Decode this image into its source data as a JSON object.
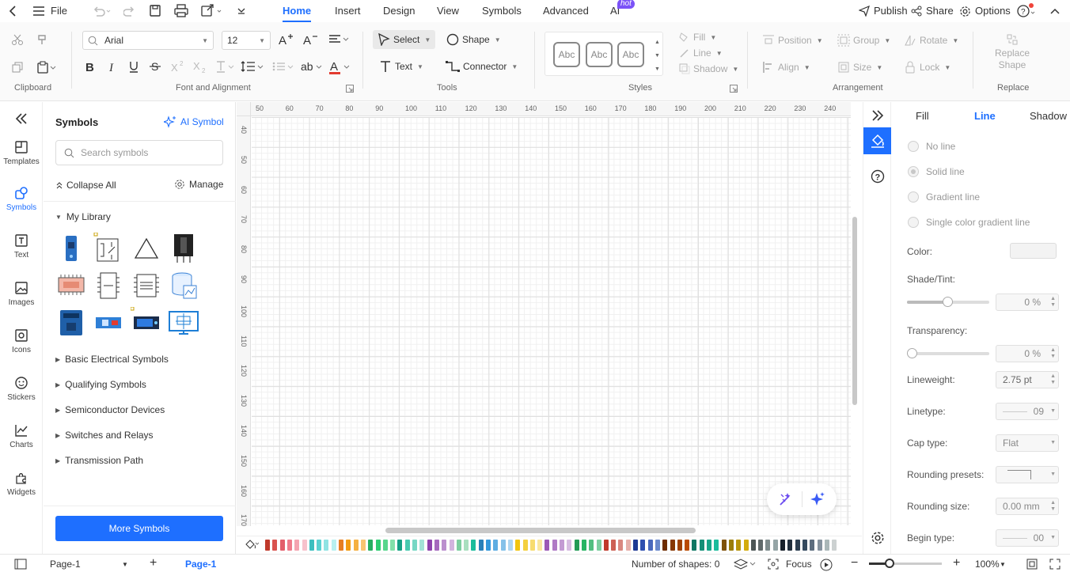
{
  "menubar": {
    "file_label": "File",
    "tabs": [
      {
        "label": "Home",
        "active": true
      },
      {
        "label": "Insert"
      },
      {
        "label": "Design"
      },
      {
        "label": "View"
      },
      {
        "label": "Symbols"
      },
      {
        "label": "Advanced"
      },
      {
        "label": "AI",
        "badge": "hot"
      }
    ],
    "publish_label": "Publish",
    "share_label": "Share",
    "options_label": "Options"
  },
  "ribbon": {
    "groups": {
      "clipboard": "Clipboard",
      "font": "Font and Alignment",
      "tools": "Tools",
      "styles": "Styles",
      "arrangement": "Arrangement",
      "replace": "Replace"
    },
    "font_family": "Arial",
    "font_size": "12",
    "select_label": "Select",
    "shape_label": "Shape",
    "text_label": "Text",
    "connector_label": "Connector",
    "style_samples": [
      "Abc",
      "Abc",
      "Abc"
    ],
    "fill_label": "Fill",
    "line_label": "Line",
    "shadow_label": "Shadow",
    "position_label": "Position",
    "group_label": "Group",
    "rotate_label": "Rotate",
    "align_label": "Align",
    "size_label": "Size",
    "lock_label": "Lock",
    "replace_shape_label": "Replace Shape"
  },
  "leftbar": {
    "items": [
      {
        "label": "Templates"
      },
      {
        "label": "Symbols",
        "active": true
      },
      {
        "label": "Text"
      },
      {
        "label": "Images"
      },
      {
        "label": "Icons"
      },
      {
        "label": "Stickers"
      },
      {
        "label": "Charts"
      },
      {
        "label": "Widgets"
      }
    ]
  },
  "symbols_panel": {
    "title": "Symbols",
    "ai_symbol_label": "AI Symbol",
    "search_placeholder": "Search symbols",
    "collapse_all_label": "Collapse All",
    "manage_label": "Manage",
    "my_library_label": "My Library",
    "categories": [
      "Basic Electrical Symbols",
      "Qualifying Symbols",
      "Semiconductor Devices",
      "Switches and Relays",
      "Transmission Path"
    ],
    "more_symbols_label": "More Symbols"
  },
  "ruler": {
    "top": [
      "50",
      "60",
      "70",
      "80",
      "90",
      "100",
      "110",
      "120",
      "130",
      "140",
      "150",
      "160",
      "170",
      "180",
      "190",
      "200",
      "210",
      "220",
      "230",
      "240"
    ],
    "left": [
      "40",
      "50",
      "60",
      "70",
      "80",
      "90",
      "100",
      "110",
      "120",
      "130",
      "140",
      "150",
      "160",
      "170"
    ]
  },
  "palette_colors": [
    "#c0392b",
    "#d9534f",
    "#e35d6a",
    "#ef7b8b",
    "#f4a3b0",
    "#f7c2cc",
    "#3bbfbf",
    "#5ad1d1",
    "#8fe3e3",
    "#b8f0f0",
    "#e67e22",
    "#f39c12",
    "#f5b041",
    "#f8c471",
    "#27ae60",
    "#2ecc71",
    "#58d68d",
    "#82e0aa",
    "#16a085",
    "#48c9b0",
    "#76d7c4",
    "#a3e4d7",
    "#8e44ad",
    "#a569bd",
    "#bb8fce",
    "#d2b4de",
    "#7dcea0",
    "#a9dfbf",
    "#1abc9c",
    "#2980b9",
    "#3498db",
    "#5dade2",
    "#85c1e9",
    "#aed6f1",
    "#f1c40f",
    "#f4d03f",
    "#f7dc6f",
    "#f9e79f",
    "#9b59b6",
    "#af7ac5",
    "#c39bd3",
    "#d7bde2",
    "#239b56",
    "#28b463",
    "#52be80",
    "#7dcea0",
    "#c0392b",
    "#cd6155",
    "#d98880",
    "#e6b0aa",
    "#1f3a93",
    "#2e4fb0",
    "#4a69bd",
    "#6a89cc",
    "#6e2c00",
    "#873600",
    "#a04000",
    "#ba4a00",
    "#117864",
    "#148f77",
    "#17a589",
    "#1abc9c",
    "#7e5109",
    "#9a7d0a",
    "#b7950b",
    "#d4ac0d",
    "#4d5656",
    "#616a6b",
    "#7f8c8d",
    "#95a5a6",
    "#17202a",
    "#212f3d",
    "#2c3e50",
    "#34495e",
    "#5d6d7e",
    "#85929e",
    "#aab7b8",
    "#ccd1d1"
  ],
  "right_panel": {
    "tabs": [
      {
        "label": "Fill"
      },
      {
        "label": "Line",
        "active": true
      },
      {
        "label": "Shadow"
      }
    ],
    "line_options": [
      "No line",
      "Solid line",
      "Gradient line",
      "Single color gradient line"
    ],
    "color_label": "Color:",
    "shade_label": "Shade/Tint:",
    "shade_value": "0 %",
    "transparency_label": "Transparency:",
    "transparency_value": "0 %",
    "lineweight_label": "Lineweight:",
    "lineweight_value": "2.75 pt",
    "linetype_label": "Linetype:",
    "linetype_value": "09",
    "cap_label": "Cap type:",
    "cap_value": "Flat",
    "rounding_presets_label": "Rounding presets:",
    "rounding_size_label": "Rounding size:",
    "rounding_size_value": "0.00 mm",
    "begin_type_label": "Begin type:",
    "begin_type_value": "00"
  },
  "status": {
    "page_selector": "Page-1",
    "page_tab": "Page-1",
    "shapes_label": "Number of shapes: 0",
    "focus_label": "Focus",
    "zoom": "100%"
  }
}
